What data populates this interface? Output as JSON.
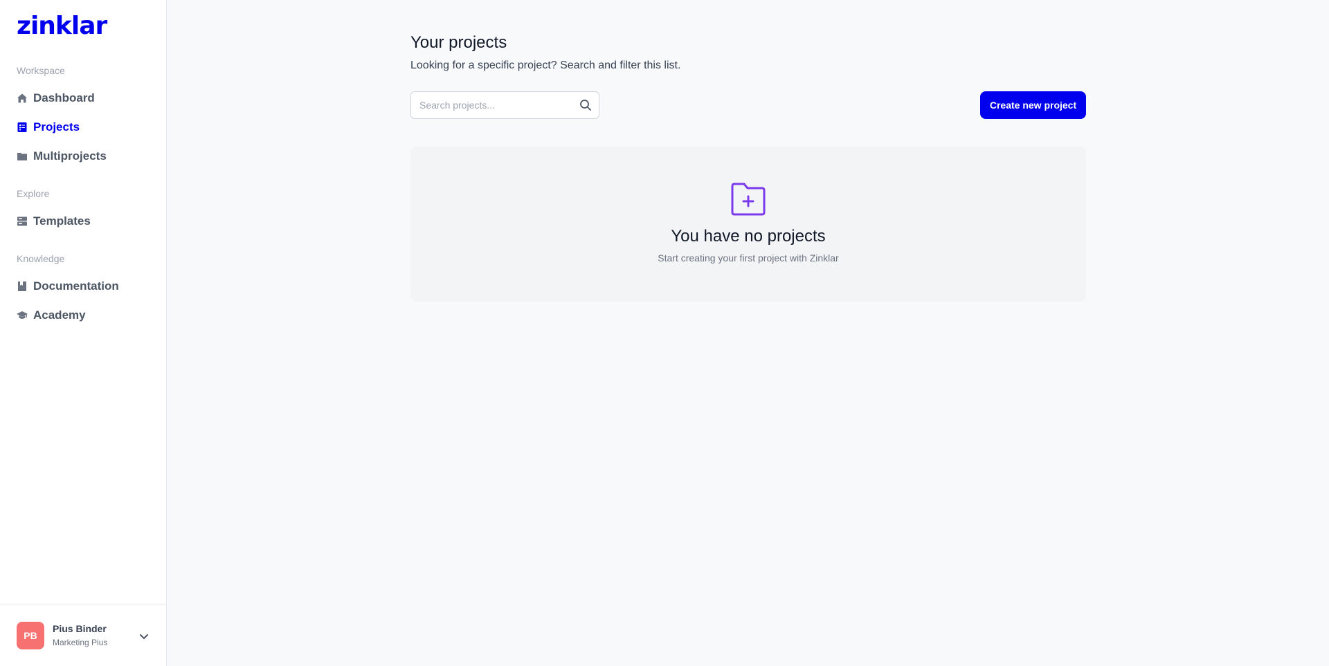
{
  "brand": {
    "logo_text": "zinklar",
    "accent_color": "#0000ee"
  },
  "sidebar": {
    "sections": [
      {
        "label": "Workspace"
      },
      {
        "label": "Explore"
      },
      {
        "label": "Knowledge"
      }
    ],
    "items": [
      {
        "label": "Dashboard",
        "icon": "home-icon",
        "active": false
      },
      {
        "label": "Projects",
        "icon": "projects-icon",
        "active": true
      },
      {
        "label": "Multiprojects",
        "icon": "folder-icon",
        "active": false
      },
      {
        "label": "Templates",
        "icon": "templates-icon",
        "active": false
      },
      {
        "label": "Documentation",
        "icon": "book-icon",
        "active": false
      },
      {
        "label": "Academy",
        "icon": "graduation-cap-icon",
        "active": false
      }
    ],
    "user": {
      "initials": "PB",
      "name": "Pius Binder",
      "organization": "Marketing Pius",
      "avatar_color": "#f87171"
    }
  },
  "main": {
    "title": "Your projects",
    "subtitle": "Looking for a specific project? Search and filter this list.",
    "search": {
      "placeholder": "Search projects...",
      "value": ""
    },
    "create_button_label": "Create new project",
    "empty_state": {
      "icon": "folder-plus-icon",
      "title": "You have no projects",
      "subtitle": "Start creating your first project with Zinklar",
      "icon_color": "#7c3aed"
    }
  }
}
